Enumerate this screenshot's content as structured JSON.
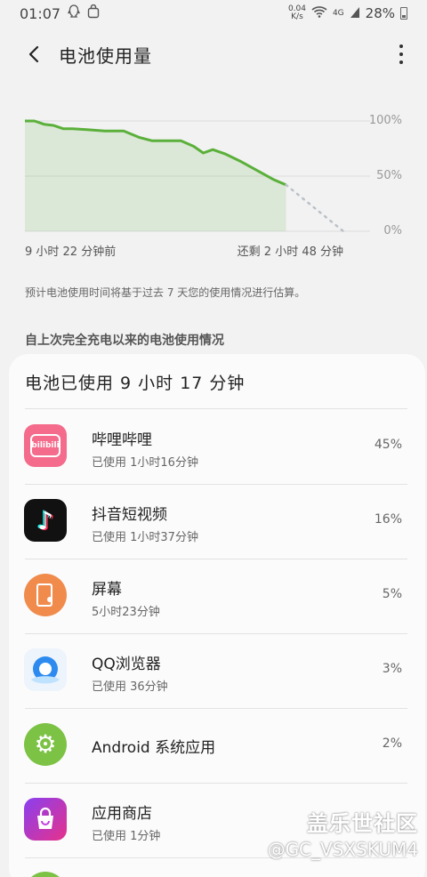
{
  "status_bar": {
    "time": "01:07",
    "net_speed_value": "0.04",
    "net_speed_unit": "K/s",
    "network": "4G",
    "battery": "28%"
  },
  "header": {
    "title": "电池使用量"
  },
  "chart": {
    "y_ticks": [
      "100%",
      "50%",
      "0%"
    ],
    "x_left_label": "9 小时 22 分钟前",
    "x_right_label": "还剩 2 小时 48 分钟"
  },
  "chart_data": {
    "type": "line",
    "xlabel": "",
    "ylabel": "",
    "ylim": [
      0,
      100
    ],
    "series": [
      {
        "style": "solid",
        "color": "#5ab03a",
        "x": [
          0,
          0.03,
          0.06,
          0.09,
          0.12,
          0.15,
          0.2,
          0.25,
          0.31,
          0.36,
          0.4,
          0.45,
          0.49,
          0.53,
          0.56,
          0.59,
          0.63,
          0.68,
          0.73,
          0.78,
          0.82
        ],
        "y": [
          100,
          100,
          97,
          96,
          93,
          93,
          92,
          91,
          91,
          85,
          82,
          82,
          82,
          77,
          71,
          74,
          70,
          63,
          55,
          47,
          42
        ]
      },
      {
        "style": "dotted",
        "color": "#b9c2c8",
        "x": [
          0.82,
          1.0
        ],
        "y": [
          42,
          0
        ]
      }
    ]
  },
  "note": "预计电池使用时间将基于过去 7 天您的使用情况进行估算。",
  "section_title": "自上次完全充电以来的电池使用情况",
  "card": {
    "title": "电池已使用 9 小时 17 分钟",
    "apps": [
      {
        "name": "哔哩哔哩",
        "sub": "已使用 1小时16分钟",
        "pct": "45%",
        "icon": "bilibili-icon",
        "icon_text": "bilibili",
        "color": "#f46b8c"
      },
      {
        "name": "抖音短视频",
        "sub": "已使用 1小时37分钟",
        "pct": "16%",
        "icon": "douyin-icon",
        "icon_text": "♪",
        "color": "#111111"
      },
      {
        "name": "屏幕",
        "sub": "5小时23分钟",
        "pct": "5%",
        "icon": "screen-icon",
        "icon_text": "",
        "color": "#f08b4c"
      },
      {
        "name": "QQ浏览器",
        "sub": "已使用 36分钟",
        "pct": "3%",
        "icon": "qq-browser-icon",
        "icon_text": "",
        "color": "#2d8bf0"
      },
      {
        "name": "Android 系统应用",
        "sub": "",
        "pct": "2%",
        "icon": "settings-gear-icon",
        "icon_text": "⚙",
        "color": "#7cc244"
      },
      {
        "name": "应用商店",
        "sub": "已使用 1分钟",
        "pct": "",
        "icon": "app-store-icon",
        "icon_text": "",
        "color": "#c23fe0"
      }
    ]
  },
  "watermark": {
    "logo": "盖乐世社区",
    "user": "@GC_VSXSKUM4"
  }
}
